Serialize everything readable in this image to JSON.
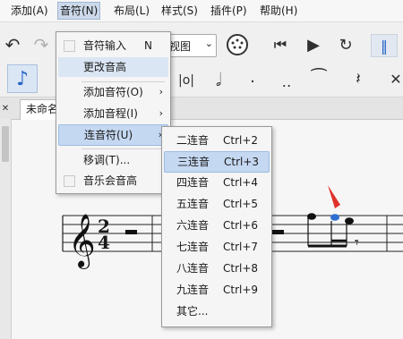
{
  "menubar": {
    "items": [
      {
        "label": "添加(A)"
      },
      {
        "label": "音符(N)"
      },
      {
        "label": "布局(L)"
      },
      {
        "label": "样式(S)"
      },
      {
        "label": "插件(P)"
      },
      {
        "label": "帮助(H)"
      }
    ]
  },
  "toolbar": {
    "view_select_value": "视图"
  },
  "tab": {
    "title": "未命名"
  },
  "notes_menu": {
    "items": [
      {
        "label": "音符输入",
        "shortcut": "N"
      },
      {
        "label": "更改音高"
      },
      {
        "label": "添加音符(O)"
      },
      {
        "label": "添加音程(I)"
      },
      {
        "label": "连音符(U)"
      },
      {
        "label": "移调(T)..."
      },
      {
        "label": "音乐会音高"
      }
    ]
  },
  "tuplet_menu": {
    "items": [
      {
        "label": "二连音",
        "shortcut": "Ctrl+2"
      },
      {
        "label": "三连音",
        "shortcut": "Ctrl+3"
      },
      {
        "label": "四连音",
        "shortcut": "Ctrl+4"
      },
      {
        "label": "五连音",
        "shortcut": "Ctrl+5"
      },
      {
        "label": "六连音",
        "shortcut": "Ctrl+6"
      },
      {
        "label": "七连音",
        "shortcut": "Ctrl+7"
      },
      {
        "label": "八连音",
        "shortcut": "Ctrl+8"
      },
      {
        "label": "九连音",
        "shortcut": "Ctrl+9"
      },
      {
        "label": "其它..."
      }
    ]
  },
  "score": {
    "time_signature_top": "2",
    "time_signature_bottom": "4"
  },
  "colors": {
    "highlight": "#c5d8f1",
    "selected_note": "#2e6fd1",
    "pointer_arrow": "#e0312b"
  }
}
